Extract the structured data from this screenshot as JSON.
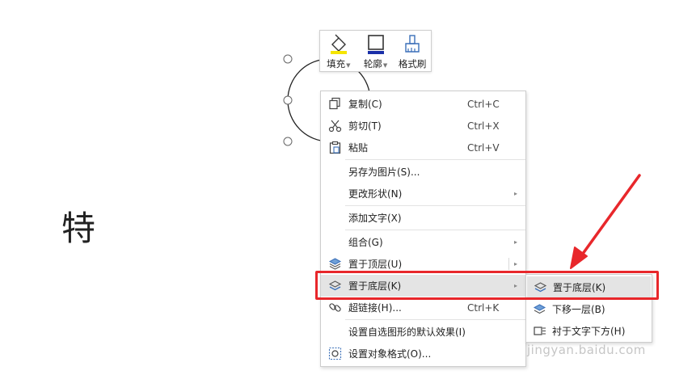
{
  "document": {
    "character": "特"
  },
  "mini_toolbar": {
    "fill_label": "填充",
    "outline_label": "轮廓",
    "format_painter_label": "格式刷",
    "fill_color": "#f5e500",
    "outline_color": "#1a2fa8"
  },
  "context_menu": {
    "items": [
      {
        "label": "复制(C)",
        "shortcut": "Ctrl+C",
        "icon": "copy-icon"
      },
      {
        "label": "剪切(T)",
        "shortcut": "Ctrl+X",
        "icon": "scissors-icon"
      },
      {
        "label": "粘贴",
        "shortcut": "Ctrl+V",
        "icon": "clipboard-icon"
      },
      {
        "label": "另存为图片(S)..."
      },
      {
        "label": "更改形状(N)",
        "has_submenu": true
      },
      {
        "label": "添加文字(X)"
      },
      {
        "label": "组合(G)",
        "has_submenu": true
      },
      {
        "label": "置于顶层(U)",
        "has_submenu": true,
        "icon": "bring-to-front-icon"
      },
      {
        "label": "置于底层(K)",
        "has_submenu": true,
        "icon": "send-to-back-icon",
        "highlighted": true
      },
      {
        "label": "超链接(H)...",
        "shortcut": "Ctrl+K",
        "icon": "link-icon"
      },
      {
        "label": "设置自选图形的默认效果(I)"
      },
      {
        "label": "设置对象格式(O)...",
        "icon": "format-object-icon"
      }
    ],
    "arrow_glyph": "▸"
  },
  "submenu": {
    "items": [
      {
        "label": "置于底层(K)",
        "icon": "send-to-back-icon",
        "highlighted": true
      },
      {
        "label": "下移一层(B)",
        "icon": "send-backward-icon"
      },
      {
        "label": "衬于文字下方(H)",
        "icon": "behind-text-icon"
      }
    ]
  },
  "annotation": {
    "highlight_color": "#e8272b"
  },
  "watermark": "jingyan.baidu.com"
}
